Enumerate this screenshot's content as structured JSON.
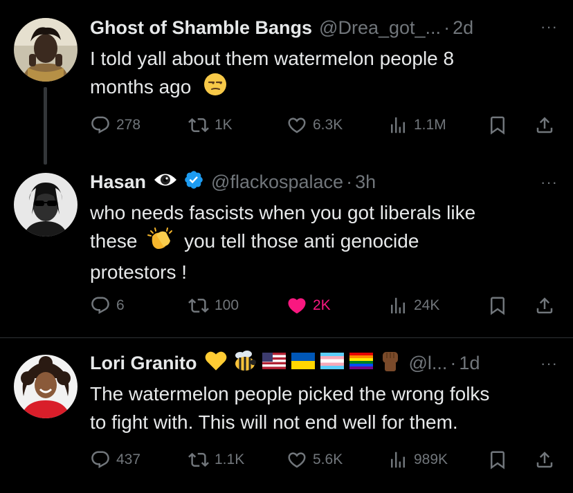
{
  "tweets": [
    {
      "name": "Ghost of Shamble Bangs",
      "handle": "@Drea_got_...",
      "dot": "·",
      "time": "2d",
      "more": "···",
      "text_lines": [
        "I told yall about them watermelon people 8",
        "months ago"
      ],
      "emoji_after_text": "unamused-face",
      "replies": "278",
      "retweets": "1K",
      "likes": "6.3K",
      "views": "1.1M",
      "liked": false
    },
    {
      "name": "Hasan",
      "handle": "@flackospalace",
      "dot": "·",
      "time": "3h",
      "more": "···",
      "name_badges": [
        "eye-emoji",
        "verified-badge"
      ],
      "text_line1": "who needs fascists when you got liberals like",
      "text_line2_a": "these",
      "text_line2_b": "you tell those anti genocide",
      "text_line3": "protestors !",
      "inline_emoji": "clapping-hands",
      "replies": "6",
      "retweets": "100",
      "likes": "2K",
      "views": "24K",
      "liked": true
    },
    {
      "name": "Lori Granito",
      "handle": "@l...",
      "dot": "·",
      "time": "1d",
      "more": "···",
      "name_badges": [
        "yellow-heart",
        "bee",
        "us-flag",
        "ukraine-flag",
        "trans-flag",
        "rainbow-flag",
        "raised-fist"
      ],
      "text_lines": [
        "The watermelon people picked the wrong folks",
        "to fight with. This will not end well for them."
      ],
      "replies": "437",
      "retweets": "1.1K",
      "likes": "5.6K",
      "views": "989K",
      "liked": false
    }
  ],
  "colors": {
    "background": "#000000",
    "text": "#e7e9ea",
    "muted": "#71767b",
    "like_active": "#f91880",
    "verified": "#1d9bf0"
  }
}
